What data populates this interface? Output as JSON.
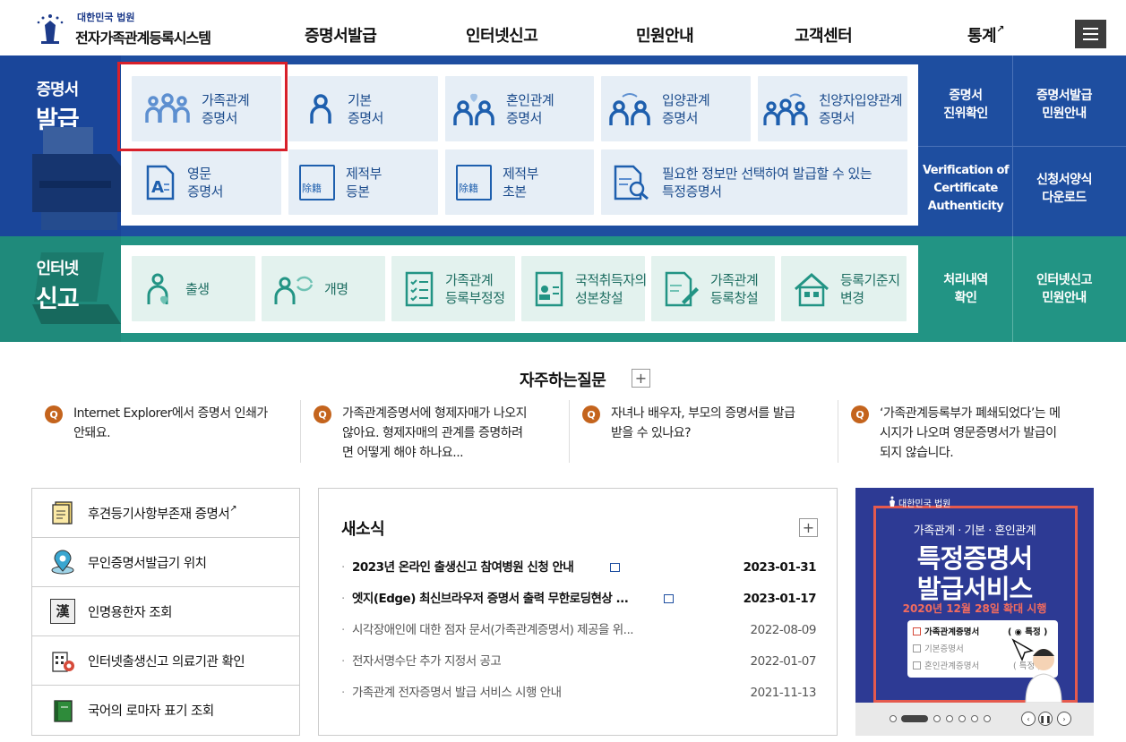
{
  "header": {
    "logo_small": "대한민국 법원",
    "logo_title": "전자가족관계등록시스템",
    "nav": [
      "증명서발급",
      "인터넷신고",
      "민원안내",
      "고객센터",
      "통계"
    ],
    "menu_icon": "hamburger-icon"
  },
  "cert_section": {
    "label_small": "증명서",
    "label_big": "발급",
    "tiles": [
      {
        "label1": "가족관계",
        "label2": "증명서",
        "icon": "family-icon"
      },
      {
        "label1": "기본",
        "label2": "증명서",
        "icon": "person-icon"
      },
      {
        "label1": "혼인관계",
        "label2": "증명서",
        "icon": "couple-heart-icon"
      },
      {
        "label1": "입양관계",
        "label2": "증명서",
        "icon": "adoption-icon"
      },
      {
        "label1": "친양자입양관계",
        "label2": "증명서",
        "icon": "full-adoption-icon"
      },
      {
        "label1": "영문",
        "label2": "증명서",
        "icon": "english-doc-icon"
      },
      {
        "label1": "제적부",
        "label2": "등본",
        "icon": "removal-register-icon",
        "icon_text": "除籍"
      },
      {
        "label1": "제적부",
        "label2": "초본",
        "icon": "removal-register-icon",
        "icon_text": "除籍"
      },
      {
        "label1": "필요한 정보만 선택하여 발급할 수 있는",
        "label2": "특정증명서",
        "icon": "search-doc-icon"
      }
    ],
    "right": [
      {
        "line1": "증명서",
        "line2": "진위확인"
      },
      {
        "line1": "증명서발급",
        "line2": "민원안내"
      },
      {
        "line1": "Verification of",
        "line2": "Certificate",
        "line3": "Authenticity"
      },
      {
        "line1": "신청서양식",
        "line2": "다운로드"
      }
    ]
  },
  "net_section": {
    "label_small": "인터넷",
    "label_big": "신고",
    "tiles": [
      {
        "label1": "출생",
        "label2": "",
        "icon": "birth-icon"
      },
      {
        "label1": "개명",
        "label2": "",
        "icon": "rename-icon"
      },
      {
        "label1": "가족관계",
        "label2": "등록부정정",
        "icon": "checklist-icon"
      },
      {
        "label1": "국적취득자의",
        "label2": "성본창설",
        "icon": "id-card-icon"
      },
      {
        "label1": "가족관계",
        "label2": "등록창설",
        "icon": "doc-pen-icon"
      },
      {
        "label1": "등록기준지",
        "label2": "변경",
        "icon": "house-icon"
      }
    ],
    "right": [
      {
        "line1": "처리내역",
        "line2": "확인"
      },
      {
        "line1": "인터넷신고",
        "line2": "민원안내"
      }
    ]
  },
  "faq": {
    "title": "자주하는질문",
    "plus": "+",
    "badge": "Q",
    "items": [
      {
        "line1": "Internet Explorer에서 증명서 인쇄가",
        "line2": "안돼요.",
        "line3": ""
      },
      {
        "line1": "가족관계증명서에 형제자매가 나오지",
        "line2": "않아요. 형제자매의 관계를 증명하려",
        "line3": "면 어떻게 해야 하나요..."
      },
      {
        "line1": "자녀나 배우자, 부모의 증명서를 발급",
        "line2": "받을 수 있나요?",
        "line3": ""
      },
      {
        "line1": "‘가족관계등록부가 폐쇄되었다’는 메",
        "line2": "시지가 나오며 영문증명서가 발급이",
        "line3": "되지 않습니다."
      }
    ]
  },
  "quick_links": [
    {
      "label": "후견등기사항부존재 증명서",
      "icon": "document-icon",
      "external": "↗"
    },
    {
      "label": "무인증명서발급기 위치",
      "icon": "map-pin-icon"
    },
    {
      "label": "인명용한자 조회",
      "icon": "hanja-book-icon",
      "icon_text": "漢"
    },
    {
      "label": "인터넷출생신고 의료기관 확인",
      "icon": "hospital-icon"
    },
    {
      "label": "국어의 로마자 표기 조회",
      "icon": "green-book-icon"
    }
  ],
  "news": {
    "title": "새소식",
    "plus": "+",
    "items": [
      {
        "title": "2023년 온라인 출생신고 참여병원 신청 안내",
        "date": "2023-01-31",
        "bold": true
      },
      {
        "title": "엣지(Edge) 최신브라우저 증명서 출력 무한로딩현상 ...",
        "date": "2023-01-17",
        "bold": true
      },
      {
        "title": "시각장애인에 대한 점자 문서(가족관계증명서) 제공을 위...",
        "date": "2022-08-09",
        "bold": false
      },
      {
        "title": "전자서명수단 추가 지정서 공고",
        "date": "2022-01-07",
        "bold": false
      },
      {
        "title": "가족관계 전자증명서 발급 서비스 시행 안내",
        "date": "2021-11-13",
        "bold": false
      }
    ]
  },
  "banner": {
    "small": "대한민국 법원",
    "sub": "가족관계 · 기본 · 혼인관계",
    "big1": "특정증명서",
    "big2": "발급서비스",
    "date": "2020년 12월 28일 확대 시행",
    "opt1": "가족관계증명서",
    "opt2": "기본증명서",
    "opt3": "혼인관계증명서",
    "tag1": "( ◉ 특정 )",
    "tag2": "( 특정 )",
    "colors": {
      "bg": "#2d3a94",
      "frame": "#e55a4e"
    }
  },
  "colors": {
    "cert_bg": "#1e4ea0",
    "net_bg": "#229484",
    "highlight": "#d8202a",
    "faq_badge": "#c4641d"
  }
}
